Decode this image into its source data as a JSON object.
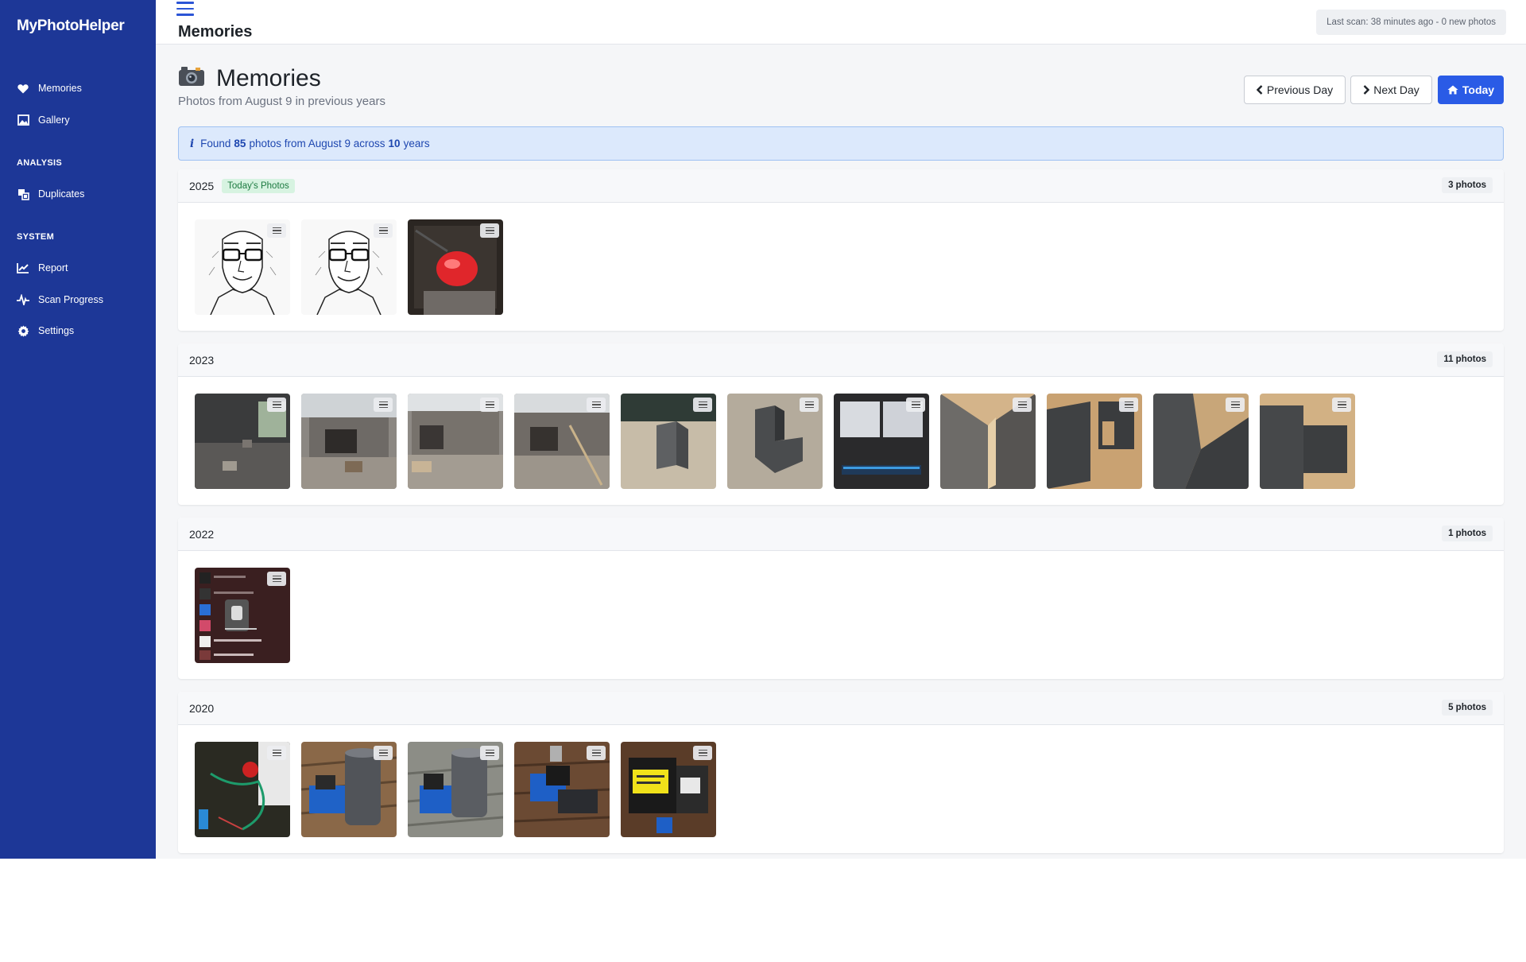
{
  "sidebar": {
    "brand": "MyPhotoHelper",
    "items": [
      {
        "label": "Memories",
        "icon": "heart-icon"
      },
      {
        "label": "Gallery",
        "icon": "image-icon"
      },
      {
        "label": "Duplicates",
        "icon": "duplicates-icon"
      },
      {
        "label": "Report",
        "icon": "chart-line-icon"
      },
      {
        "label": "Scan Progress",
        "icon": "pulse-icon"
      },
      {
        "label": "Settings",
        "icon": "gear-icon"
      }
    ],
    "sections": {
      "analysis": "ANALYSIS",
      "system": "SYSTEM"
    }
  },
  "topbar": {
    "title": "Memories",
    "scan_status": "Last scan: 38 minutes ago - 0 new photos"
  },
  "page": {
    "title": "Memories",
    "title_icon": "camera-icon",
    "subtitle": "Photos from August 9 in previous years"
  },
  "buttons": {
    "previous": "Previous Day",
    "next": "Next Day",
    "today": "Today"
  },
  "info": {
    "prefix": "Found",
    "photo_count": "85",
    "middle": "photos from August 9 across",
    "year_count": "10",
    "suffix": "years"
  },
  "years": [
    {
      "year": "2025",
      "badge": "Today's Photos",
      "count": "3 photos",
      "photos": 3
    },
    {
      "year": "2023",
      "count": "11 photos",
      "photos": 11
    },
    {
      "year": "2022",
      "count": "1 photos",
      "photos": 1
    },
    {
      "year": "2020",
      "count": "5 photos",
      "photos": 5
    }
  ],
  "colors": {
    "sidebar": "#1d3797",
    "primary": "#2a5be6",
    "info_bg": "#dce9fc",
    "today_badge": "#d7f3e1"
  }
}
